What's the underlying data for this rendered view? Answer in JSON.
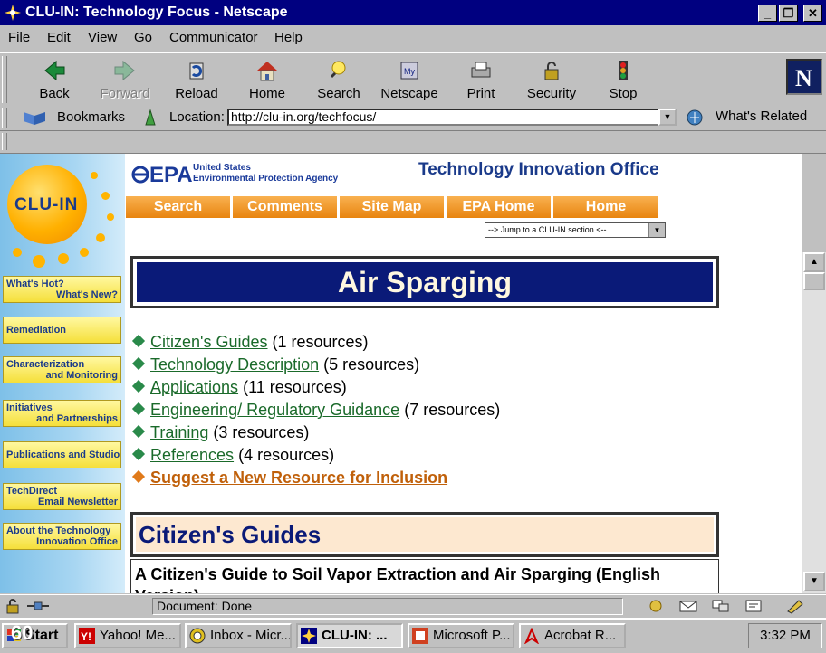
{
  "window": {
    "title": "CLU-IN: Technology Focus - Netscape",
    "controls": [
      "_",
      "❐",
      "✕"
    ]
  },
  "menu": [
    "File",
    "Edit",
    "View",
    "Go",
    "Communicator",
    "Help"
  ],
  "toolbar": [
    {
      "label": "Back",
      "icon": "back-arrow-icon",
      "enabled": true
    },
    {
      "label": "Forward",
      "icon": "forward-arrow-icon",
      "enabled": false
    },
    {
      "label": "Reload",
      "icon": "reload-icon",
      "enabled": true
    },
    {
      "label": "Home",
      "icon": "home-icon",
      "enabled": true
    },
    {
      "label": "Search",
      "icon": "search-icon",
      "enabled": true
    },
    {
      "label": "Netscape",
      "icon": "netscape-icon",
      "enabled": true
    },
    {
      "label": "Print",
      "icon": "print-icon",
      "enabled": true
    },
    {
      "label": "Security",
      "icon": "lock-icon",
      "enabled": true
    },
    {
      "label": "Stop",
      "icon": "stop-icon",
      "enabled": true
    }
  ],
  "location": {
    "bookmarks_label": "Bookmarks",
    "location_label": "Location:",
    "url": "http://clu-in.org/techfocus/",
    "whats_related": "What's Related"
  },
  "page": {
    "sidebar": {
      "logo_text": "CLU-IN",
      "items": [
        {
          "line1": "What's Hot?",
          "line2": "What's New?"
        },
        {
          "line1": "Remediation",
          "line2": ""
        },
        {
          "line1": "Characterization",
          "line2": "and Monitoring"
        },
        {
          "line1": "Initiatives",
          "line2": "and Partnerships"
        },
        {
          "line1": "Publications and Studio",
          "line2": ""
        },
        {
          "line1": "TechDirect",
          "line2": "Email Newsletter"
        },
        {
          "line1": "About the Technology",
          "line2": "Innovation Office"
        }
      ]
    },
    "header": {
      "epa_logo": "EPA",
      "agency_line1": "United States",
      "agency_line2": "Environmental Protection Agency",
      "office": "Technology Innovation Office"
    },
    "nav": [
      "Search",
      "Comments",
      "Site Map",
      "EPA Home",
      "Home"
    ],
    "jump_select": "--> Jump to a CLU-IN section <--",
    "title": "Air Sparging",
    "resources": [
      {
        "link": "Citizen's Guides",
        "count": "(1 resources)"
      },
      {
        "link": "Technology Description",
        "count": "(5 resources)"
      },
      {
        "link": "Applications",
        "count": "(11 resources)"
      },
      {
        "link": "Engineering/ Regulatory Guidance",
        "count": "(7 resources)"
      },
      {
        "link": "Training",
        "count": "(3 resources)"
      },
      {
        "link": "References",
        "count": "(4 resources)"
      }
    ],
    "suggest": "Suggest a New Resource for Inclusion",
    "section_heading": "Citizen's Guides",
    "entry_title": "A Citizen's Guide to Soil Vapor Extraction and Air Sparging (English Version)"
  },
  "status": {
    "text": "Document: Done"
  },
  "taskbar": {
    "start": "Start",
    "items": [
      {
        "label": "Yahoo! Me...",
        "active": false
      },
      {
        "label": "Inbox - Micr...",
        "active": false
      },
      {
        "label": "CLU-IN: ...",
        "active": true
      },
      {
        "label": "Microsoft P...",
        "active": false
      },
      {
        "label": "Acrobat R...",
        "active": false
      }
    ],
    "clock": "3:32 PM",
    "page_number": "60"
  },
  "colors": {
    "title_bar": "#000080",
    "heading_bg": "#0a1a78",
    "nav_orange": "#f0961e",
    "link_green": "#1a6a2a",
    "suggest_orange": "#c0600a"
  }
}
